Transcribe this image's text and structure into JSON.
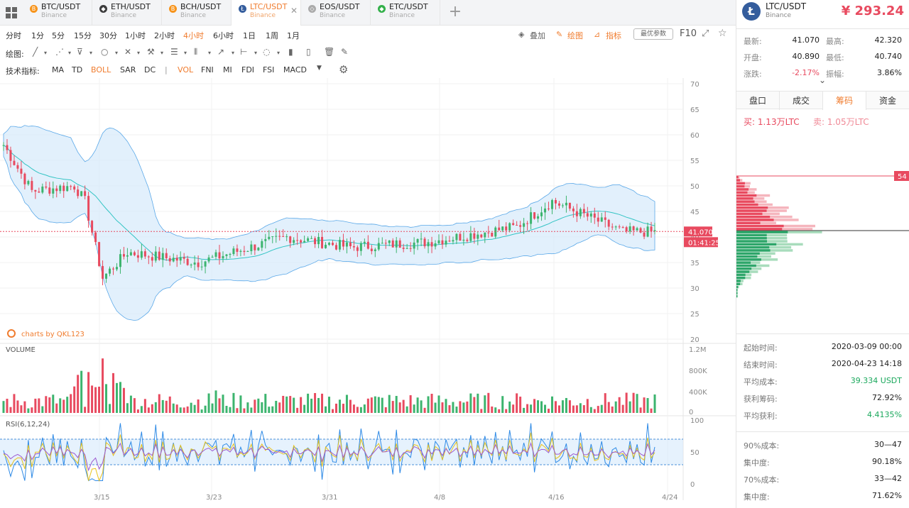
{
  "tabs": [
    {
      "pair": "BTC/USDT",
      "exchange": "Binance",
      "color": "#f7931a",
      "glyph": "B"
    },
    {
      "pair": "ETH/USDT",
      "exchange": "Binance",
      "color": "#3c3c3d",
      "glyph": "◆"
    },
    {
      "pair": "BCH/USDT",
      "exchange": "Binance",
      "color": "#f7931a",
      "glyph": "B"
    },
    {
      "pair": "LTC/USDT",
      "exchange": "Binance",
      "color": "#345d9d",
      "glyph": "Ł",
      "active": true
    },
    {
      "pair": "EOS/USDT",
      "exchange": "Binance",
      "color": "#aaaaaa",
      "glyph": "◇"
    },
    {
      "pair": "ETC/USDT",
      "exchange": "Binance",
      "color": "#33b04a",
      "glyph": "◆"
    }
  ],
  "periods": [
    "分时",
    "1分",
    "5分",
    "15分",
    "30分",
    "1小时",
    "2小时",
    "4小时",
    "6小时",
    "1日",
    "1周",
    "1月"
  ],
  "active_period": "4小时",
  "toolbar": {
    "overlay": "叠加",
    "draw": "绘图",
    "indicator": "指标",
    "params": "最优参数",
    "f10": "F10"
  },
  "draw_label": "绘图:",
  "indicator_label": "技术指标:",
  "indicators": [
    "MA",
    "TD",
    "BOLL",
    "SAR",
    "DC",
    "|",
    "VOL",
    "FNI",
    "MI",
    "FDI",
    "FSI",
    "MACD"
  ],
  "active_indicators": [
    "BOLL",
    "VOL"
  ],
  "chart_data": {
    "type": "candlestick",
    "main": {
      "y_ticks": [
        70,
        65,
        60,
        55,
        50,
        45,
        40,
        35,
        30,
        25,
        20
      ],
      "ylim": [
        20,
        70
      ],
      "last_price": "41.070",
      "countdown": "01:41:25",
      "watermark": "charts by QKL123"
    },
    "x_ticks": [
      "3/15",
      "3/23",
      "3/31",
      "4/8",
      "4/16",
      "4/24"
    ],
    "volume": {
      "label": "VOLUME",
      "y_ticks": [
        "1.2M",
        "800K",
        "400K",
        "0"
      ],
      "ylim": [
        0,
        1200000
      ]
    },
    "rsi": {
      "label": "RSI(6,12,24)",
      "y_ticks": [
        100,
        50,
        0
      ],
      "bands": [
        30,
        70
      ],
      "ylim": [
        0,
        100
      ]
    },
    "colors": {
      "up": "#3cb46e",
      "down": "#e84a5f",
      "band": "#5aa8e8",
      "mid": "#33c4c4"
    }
  },
  "side": {
    "pair": "LTC/USDT",
    "exchange": "Binance",
    "price": "¥ 293.24",
    "stats": [
      {
        "k": "最新:",
        "v": "41.070",
        "k2": "最高:",
        "v2": "42.320"
      },
      {
        "k": "开盘:",
        "v": "40.890",
        "k2": "最低:",
        "v2": "40.740"
      },
      {
        "k": "涨跌:",
        "v": "-2.17%",
        "k2": "振幅:",
        "v2": "3.86%"
      }
    ],
    "tabs": [
      "盘口",
      "成交",
      "筹码",
      "资金"
    ],
    "active_tab": "筹码",
    "buy": "买: 1.13万LTC",
    "sell": "卖: 1.05万LTC",
    "top_marker": "54",
    "info": [
      {
        "k": "起始时间:",
        "v": "2020-03-09 00:00"
      },
      {
        "k": "结束时间:",
        "v": "2020-04-23 14:18"
      },
      {
        "k": "平均成本:",
        "v": "39.334 USDT",
        "g": true
      },
      {
        "k": "获利筹码:",
        "v": "72.92%"
      },
      {
        "k": "平均获利:",
        "v": "4.4135%",
        "g": true
      }
    ],
    "info2": [
      {
        "k": "90%成本:",
        "v": "30—47"
      },
      {
        "k": "集中度:",
        "v": "90.18%"
      },
      {
        "k": "70%成本:",
        "v": "33—42"
      },
      {
        "k": "集中度:",
        "v": "71.62%"
      }
    ]
  }
}
